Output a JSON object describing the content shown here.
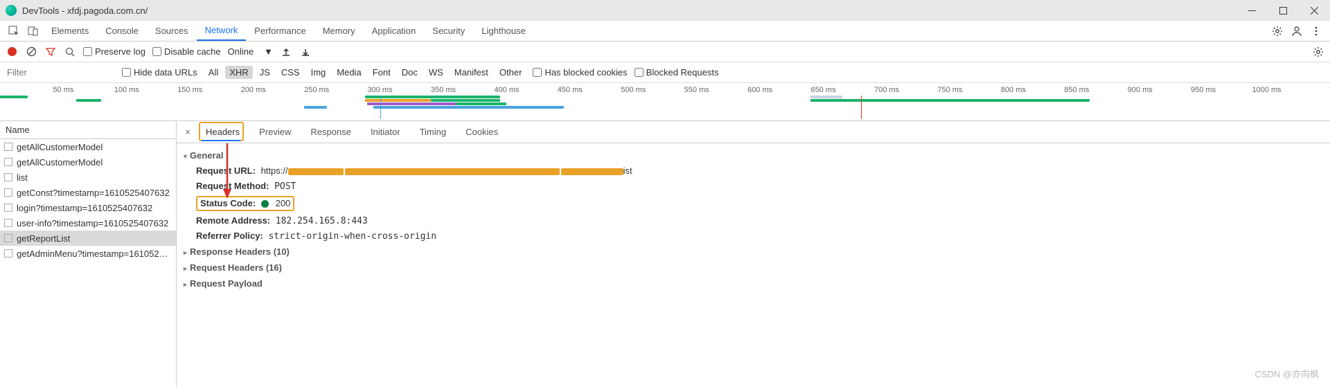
{
  "window": {
    "title": "DevTools - xfdj.pagoda.com.cn/"
  },
  "panels": {
    "tabs": [
      "Elements",
      "Console",
      "Sources",
      "Network",
      "Performance",
      "Memory",
      "Application",
      "Security",
      "Lighthouse"
    ],
    "active_index": 3
  },
  "net_controls": {
    "preserve_log_label": "Preserve log",
    "disable_cache_label": "Disable cache",
    "throttling": "Online"
  },
  "filter_row": {
    "placeholder": "Filter",
    "hide_data_urls_label": "Hide data URLs",
    "types": [
      "All",
      "XHR",
      "JS",
      "CSS",
      "Img",
      "Media",
      "Font",
      "Doc",
      "WS",
      "Manifest",
      "Other"
    ],
    "active_type_index": 1,
    "blocked_cookies_label": "Has blocked cookies",
    "blocked_requests_label": "Blocked Requests"
  },
  "timeline": {
    "ticks": [
      "50 ms",
      "100 ms",
      "150 ms",
      "200 ms",
      "250 ms",
      "300 ms",
      "350 ms",
      "400 ms",
      "450 ms",
      "500 ms",
      "550 ms",
      "600 ms",
      "650 ms",
      "700 ms",
      "750 ms",
      "800 ms",
      "850 ms",
      "900 ms",
      "950 ms",
      "1000 ms"
    ]
  },
  "requests": {
    "header": "Name",
    "items": [
      {
        "name": "getAllCustomerModel"
      },
      {
        "name": "getAllCustomerModel"
      },
      {
        "name": "list"
      },
      {
        "name": "getConst?timestamp=1610525407632"
      },
      {
        "name": "login?timestamp=1610525407632"
      },
      {
        "name": "user-info?timestamp=1610525407632"
      },
      {
        "name": "getReportList"
      },
      {
        "name": "getAdminMenu?timestamp=161052540..."
      }
    ],
    "selected_index": 6
  },
  "details": {
    "tabs": [
      "Headers",
      "Preview",
      "Response",
      "Initiator",
      "Timing",
      "Cookies"
    ],
    "active_index": 0,
    "general_label": "General",
    "general": {
      "request_url_k": "Request URL:",
      "request_url_prefix": "https://",
      "request_url_suffix": "ist",
      "request_method_k": "Request Method:",
      "request_method_v": "POST",
      "status_code_k": "Status Code:",
      "status_code_v": "200",
      "remote_address_k": "Remote Address:",
      "remote_address_v": "182.254.165.8:443",
      "referrer_policy_k": "Referrer Policy:",
      "referrer_policy_v": "strict-origin-when-cross-origin"
    },
    "response_headers_label": "Response Headers (10)",
    "request_headers_label": "Request Headers (16)",
    "request_payload_label": "Request Payload"
  },
  "watermark": "CSDN @亦向枫",
  "chart_data": {
    "type": "gantt-overview",
    "x_unit": "ms",
    "x_range": [
      0,
      1050
    ],
    "ticks_ms": [
      50,
      100,
      150,
      200,
      250,
      300,
      350,
      400,
      450,
      500,
      550,
      600,
      650,
      700,
      750,
      800,
      850,
      900,
      950,
      1000
    ],
    "load_marker_ms": 680,
    "domcontent_marker_ms": 300,
    "bars": [
      {
        "row": 0,
        "start": 0,
        "end": 22,
        "color": "#1ab36b"
      },
      {
        "row": 1,
        "start": 60,
        "end": 80,
        "color": "#1ab36b"
      },
      {
        "row": 3,
        "start": 240,
        "end": 258,
        "color": "#4aa3df"
      },
      {
        "row": 0,
        "start": 288,
        "end": 395,
        "color": "#1ab36b"
      },
      {
        "row": 1,
        "start": 288,
        "end": 340,
        "color": "#e9a227"
      },
      {
        "row": 1,
        "start": 340,
        "end": 395,
        "color": "#1ab36b"
      },
      {
        "row": 2,
        "start": 290,
        "end": 360,
        "color": "#a05ac8"
      },
      {
        "row": 2,
        "start": 360,
        "end": 400,
        "color": "#1ab36b"
      },
      {
        "row": 3,
        "start": 295,
        "end": 445,
        "color": "#4aa3df"
      },
      {
        "row": 0,
        "start": 640,
        "end": 665,
        "color": "#c7d2e0"
      },
      {
        "row": 1,
        "start": 640,
        "end": 680,
        "color": "#1ab36b"
      },
      {
        "row": 1,
        "start": 680,
        "end": 860,
        "color": "#1ab36b"
      }
    ]
  }
}
